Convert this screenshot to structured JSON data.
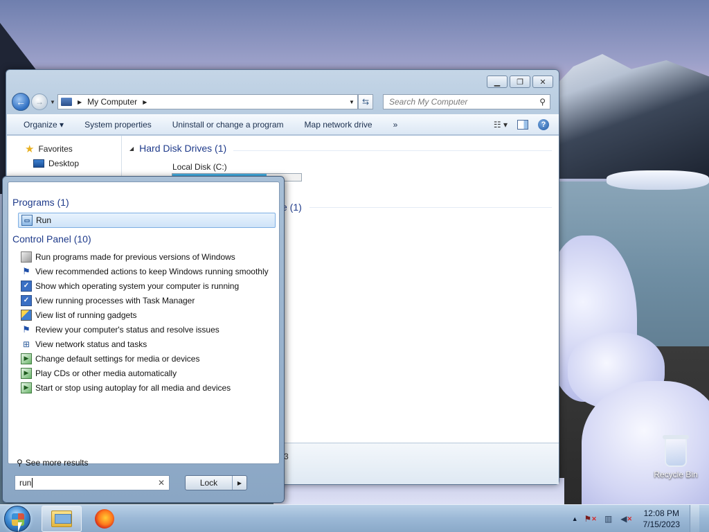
{
  "explorer": {
    "address": {
      "text": "My Computer"
    },
    "search_placeholder": "Search My Computer",
    "toolbar": {
      "organize": "Organize",
      "system_properties": "System properties",
      "uninstall": "Uninstall or change a program",
      "map_drive": "Map network drive",
      "more": "»"
    },
    "nav_pane": {
      "favorites": "Favorites",
      "desktop": "Desktop"
    },
    "groups": {
      "hard_disk": "Hard Disk Drives (1)",
      "removable_fragment": "e (1)"
    },
    "drive": {
      "label": "Local Disk (C:)",
      "used_fraction": 0.73
    },
    "status_fragment": "3"
  },
  "start_menu": {
    "programs_header": "Programs (1)",
    "programs": [
      {
        "label": "Run",
        "icon": "run-icon"
      }
    ],
    "control_panel_header": "Control Panel (10)",
    "control_panel": [
      {
        "label": "Run programs made for previous versions of Windows",
        "icon": "compat-icon"
      },
      {
        "label": "View recommended actions to keep Windows running smoothly",
        "icon": "action-center-flag-icon"
      },
      {
        "label": "Show which operating system your computer is running",
        "icon": "system-icon"
      },
      {
        "label": "View running processes with Task Manager",
        "icon": "task-manager-icon"
      },
      {
        "label": "View list of running gadgets",
        "icon": "gadgets-icon"
      },
      {
        "label": "Review your computer's status and resolve issues",
        "icon": "action-center-flag-icon"
      },
      {
        "label": "View network status and tasks",
        "icon": "network-icon"
      },
      {
        "label": "Change default settings for media or devices",
        "icon": "autoplay-icon"
      },
      {
        "label": "Play CDs or other media automatically",
        "icon": "autoplay-icon"
      },
      {
        "label": "Start or stop using autoplay for all media and devices",
        "icon": "autoplay-icon"
      }
    ],
    "see_more": "See more results",
    "search_value": "run",
    "lock_label": "Lock"
  },
  "desktop": {
    "recycle_bin": "Recycle Bin"
  },
  "taskbar": {
    "time": "12:08 PM",
    "date": "7/15/2023"
  }
}
